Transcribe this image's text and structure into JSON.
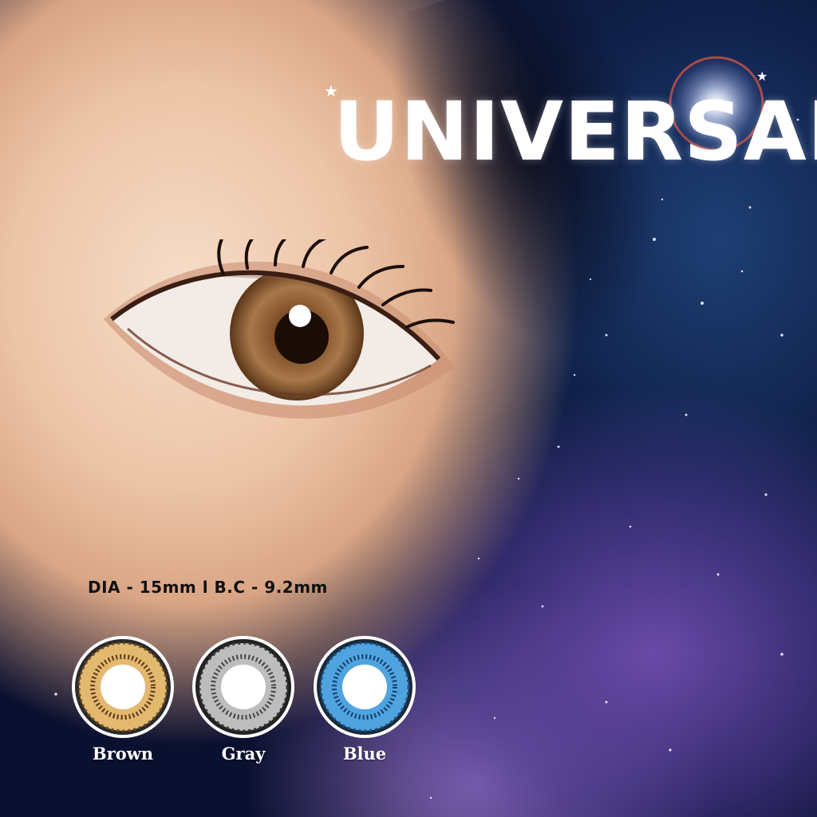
{
  "headline": "UNIVERSAL",
  "specs": "DIA  -  15mm   l   B.C  -  9.2mm",
  "colors": {
    "skin": "#ecc4a6",
    "nebula_blue": "#1e3f74",
    "nebula_purple": "#6a4aa8",
    "iris_brown": "#9a6a3e"
  },
  "lens_options": [
    {
      "label": "Brown",
      "ring": "#e8c07a",
      "dark": "#6b4a1e"
    },
    {
      "label": "Gray",
      "ring": "#c8c8c8",
      "dark": "#3b3b3b"
    },
    {
      "label": "Blue",
      "ring": "#5aaee6",
      "dark": "#1a4f86"
    }
  ]
}
